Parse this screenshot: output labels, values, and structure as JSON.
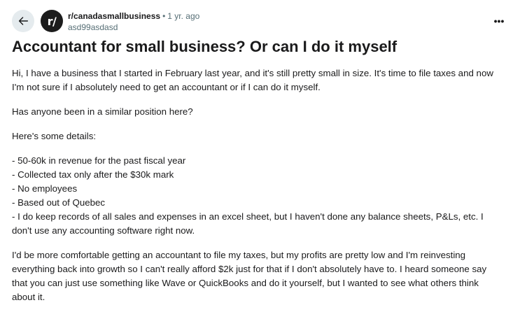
{
  "header": {
    "subreddit": "r/canadasmallbusiness",
    "separator": "•",
    "age": "1 yr. ago",
    "username": "asd99asdasd",
    "avatar_text": "r/",
    "more_label": "•••"
  },
  "post": {
    "title": "Accountant for small business? Or can I do it myself",
    "paragraphs": [
      "Hi, I have a business that I started in February last year, and it's still pretty small in size. It's time to file taxes and now I'm not sure if I absolutely need to get an accountant or if I can do it myself.",
      "Has anyone been in a similar position here?",
      "Here's some details:"
    ],
    "details": [
      "- 50-60k in revenue for the past fiscal year",
      "- Collected tax only after the $30k mark",
      "- No employees",
      "- Based out of Quebec",
      "- I do keep records of all sales and expenses in an excel sheet, but I haven't done any balance sheets, P&Ls, etc. I don't use any accounting software right now."
    ],
    "closing": "I'd be more comfortable getting an accountant to file my taxes, but my profits are pretty low and I'm reinvesting everything back into growth so I can't really afford $2k just for that if I don't absolutely have to. I heard someone say that you can just use something like Wave or QuickBooks and do it yourself, but I wanted to see what others think about it."
  },
  "icons": {
    "back": "arrow-left-icon",
    "more": "more-horizontal-icon"
  }
}
